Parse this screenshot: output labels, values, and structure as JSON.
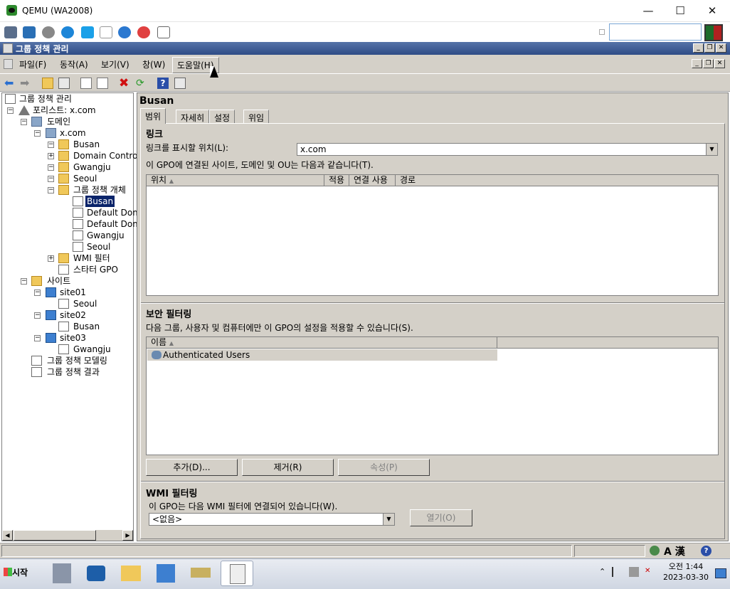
{
  "qemu": {
    "title": "QEMU (WA2008)",
    "minimize": "—",
    "maximize": "☐",
    "close": "✕"
  },
  "mmc": {
    "title": "그룹 정책 관리"
  },
  "menu": {
    "file": "파일(F)",
    "action": "동작(A)",
    "view": "보기(V)",
    "window": "창(W)",
    "help": "도움말(H)"
  },
  "tree": {
    "root": "그룹 정책 관리",
    "forest": "포리스트: x.com",
    "domains": "도메인",
    "domain": "x.com",
    "ou_busan": "Busan",
    "ou_dc": "Domain Contro",
    "ou_gwangju": "Gwangju",
    "ou_seoul": "Seoul",
    "gpo_objects": "그룹 정책 개체",
    "gpo_busan": "Busan",
    "gpo_default1": "Default Dom",
    "gpo_default2": "Default Dom",
    "gpo_gwangju": "Gwangju",
    "gpo_seoul": "Seoul",
    "wmi": "WMI 필터",
    "starter": "스타터 GPO",
    "sites": "사이트",
    "site01": "site01",
    "site01_child": "Seoul",
    "site02": "site02",
    "site02_child": "Busan",
    "site03": "site03",
    "site03_child": "Gwangju",
    "modeling": "그룹 정책 모델링",
    "results": "그룹 정책 결과"
  },
  "pane": {
    "title": "Busan",
    "tabs": [
      "범위",
      "자세히",
      "설정",
      "위임"
    ],
    "links_heading": "링크",
    "links_label": "링크를 표시할 위치(L):",
    "links_value": "x.com",
    "links_desc": "이 GPO에 연결된 사이트, 도메인 및 OU는 다음과 같습니다(T).",
    "links_cols": [
      "위치",
      "적용",
      "연결 사용",
      "경로"
    ],
    "security_heading": "보안 필터링",
    "security_desc": "다음 그룹, 사용자 및 컴퓨터에만 이 GPO의 설정을 적용할 수 있습니다(S).",
    "security_col": "이름",
    "security_rows": [
      "Authenticated Users"
    ],
    "btn_add": "추가(D)...",
    "btn_remove": "제거(R)",
    "btn_props": "속성(P)",
    "wmi_heading": "WMI 필터링",
    "wmi_desc": "이 GPO는 다음 WMI 필터에 연결되어 있습니다(W).",
    "wmi_value": "<없음>",
    "wmi_open": "열기(O)"
  },
  "statusbar": {
    "ime": "A 漢"
  },
  "taskbar": {
    "start": "시작",
    "time": "오전 1:44",
    "date": "2023-03-30"
  }
}
